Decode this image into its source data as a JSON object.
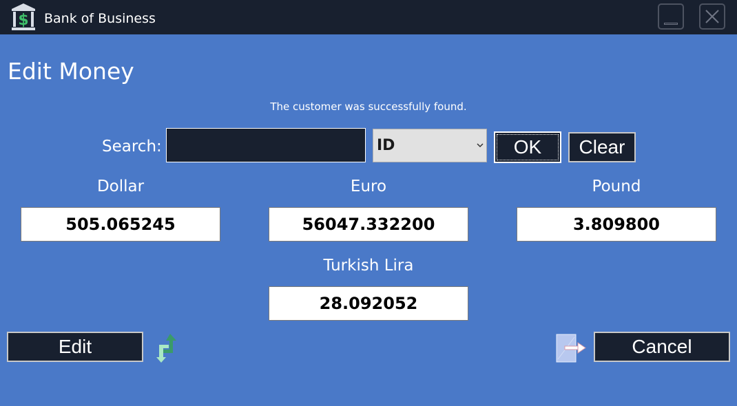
{
  "window": {
    "title": "Bank of Business",
    "logo_icon": "bank-dollar-icon",
    "minimize_icon": "minimize-icon",
    "close_icon": "close-icon"
  },
  "page": {
    "title": "Edit Money",
    "status_message": "The customer was successfully found."
  },
  "search": {
    "label": "Search:",
    "value": "",
    "placeholder": "",
    "type_selected": "ID",
    "ok_label": "OK",
    "clear_label": "Clear"
  },
  "currencies": [
    {
      "label": "Dollar",
      "value": "505.065245"
    },
    {
      "label": "Euro",
      "value": "56047.332200"
    },
    {
      "label": "Pound",
      "value": "3.809800"
    },
    {
      "label": "Turkish Lira",
      "value": "28.092052"
    }
  ],
  "actions": {
    "edit_label": "Edit",
    "cancel_label": "Cancel",
    "swap_icon": "swap-arrows-icon",
    "exit_icon": "exit-door-icon"
  },
  "colors": {
    "background": "#4a79c8",
    "titlebar": "#18202f",
    "button": "#18202f",
    "field": "#ffffff",
    "select": "#e1e1e1"
  }
}
